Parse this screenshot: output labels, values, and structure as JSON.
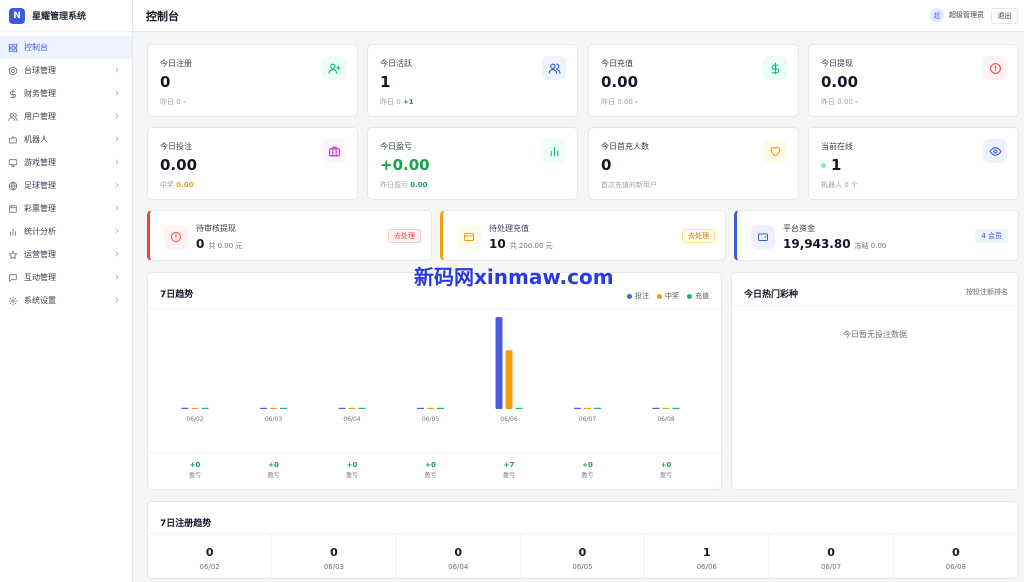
{
  "app": {
    "brand_initial": "N",
    "brand_name": "星耀管理系统"
  },
  "sidebar": {
    "items": [
      {
        "key": "dashboard",
        "label": "控制台",
        "icon": "dashboard-icon",
        "active": true,
        "has_children": false
      },
      {
        "key": "table-ball",
        "label": "台球管理",
        "icon": "target-icon",
        "active": false,
        "has_children": true
      },
      {
        "key": "finance",
        "label": "财务管理",
        "icon": "dollar-icon",
        "active": false,
        "has_children": true
      },
      {
        "key": "users",
        "label": "用户管理",
        "icon": "users-icon",
        "active": false,
        "has_children": true
      },
      {
        "key": "robots",
        "label": "机器人",
        "icon": "robot-icon",
        "active": false,
        "has_children": true
      },
      {
        "key": "games",
        "label": "游戏管理",
        "icon": "monitor-icon",
        "active": false,
        "has_children": true
      },
      {
        "key": "football",
        "label": "足球管理",
        "icon": "globe-icon",
        "active": false,
        "has_children": true
      },
      {
        "key": "lottery",
        "label": "彩票管理",
        "icon": "ticket-icon",
        "active": false,
        "has_children": true
      },
      {
        "key": "stats",
        "label": "统计分析",
        "icon": "bar-chart-icon",
        "active": false,
        "has_children": true
      },
      {
        "key": "operations",
        "label": "运营管理",
        "icon": "star-icon",
        "active": false,
        "has_children": true
      },
      {
        "key": "interaction",
        "label": "互动管理",
        "icon": "message-icon",
        "active": false,
        "has_children": true
      },
      {
        "key": "settings",
        "label": "系统设置",
        "icon": "gear-icon",
        "active": false,
        "has_children": true
      }
    ]
  },
  "header": {
    "title": "控制台",
    "avatar_text": "超",
    "admin_name": "超级管理员",
    "logout_label": "退出"
  },
  "stats": [
    {
      "label": "今日注册",
      "value": "0",
      "sub_prefix": "昨日 0",
      "sub_highlight": "-",
      "highlight_color": "#9ca3af",
      "icon": "user-plus-icon",
      "icon_bg": "#ecfdf5",
      "icon_color": "#10b981"
    },
    {
      "label": "今日活跃",
      "value": "1",
      "sub_prefix": "昨日 0",
      "sub_highlight": "+1",
      "highlight_color": "#16a34a",
      "icon": "users-icon",
      "icon_bg": "#eef2ff",
      "icon_color": "#3b5bdb"
    },
    {
      "label": "今日充值",
      "value": "0.00",
      "sub_prefix": "昨日 0.00",
      "sub_highlight": "-",
      "highlight_color": "#9ca3af",
      "icon": "dollar-icon",
      "icon_bg": "#ecfdf5",
      "icon_color": "#10b981"
    },
    {
      "label": "今日提现",
      "value": "0.00",
      "sub_prefix": "昨日 0.00",
      "sub_highlight": "-",
      "highlight_color": "#9ca3af",
      "icon": "alert-circle-icon",
      "icon_bg": "#fef2f2",
      "icon_color": "#ef4444"
    },
    {
      "label": "今日投注",
      "value": "0.00",
      "sub_prefix": "中奖",
      "sub_highlight": "0.00",
      "highlight_color": "#f59e0b",
      "icon": "briefcase-icon",
      "icon_bg": "#fdf4ff",
      "icon_color": "#c026d3"
    },
    {
      "label": "今日盈亏",
      "value": "+0.00",
      "value_color": "#16a34a",
      "sub_prefix": "昨日盈亏",
      "sub_highlight": "0.00",
      "highlight_color": "#16a34a",
      "icon": "bar-chart-icon",
      "icon_bg": "#ecfdf5",
      "icon_color": "#10b981"
    },
    {
      "label": "今日首充人数",
      "value": "0",
      "sub_prefix": "首次充值的新用户",
      "sub_highlight": "",
      "highlight_color": "#9ca3af",
      "icon": "heart-icon",
      "icon_bg": "#fffbeb",
      "icon_color": "#f59e0b"
    },
    {
      "label": "当前在线",
      "value": "1",
      "dot": true,
      "sub_prefix": "机器人 0 个",
      "sub_highlight": "",
      "highlight_color": "#9ca3af",
      "icon": "eye-icon",
      "icon_bg": "#eef2ff",
      "icon_color": "#3b5bdb"
    }
  ],
  "pending": [
    {
      "label": "待审核提现",
      "value": "0",
      "detail": "共 0.00 元",
      "button": "去处理",
      "accent": "#ef4444",
      "icon": "alert-circle-icon",
      "icon_bg": "#fef2f2",
      "btn_bg": "#fef2f2",
      "btn_color": "#ef4444",
      "btn_border": "#fecaca"
    },
    {
      "label": "待处理充值",
      "value": "10",
      "detail": "共 200.00 元",
      "button": "去处理",
      "accent": "#f59e0b",
      "icon": "credit-card-icon",
      "icon_bg": "#fffbeb",
      "btn_bg": "#fffbeb",
      "btn_color": "#d97706",
      "btn_border": "#fde68a"
    },
    {
      "label": "平台资金",
      "value": "19,943.80",
      "detail": "冻结 0.00",
      "button": "4 会员",
      "accent": "#3b5bdb",
      "icon": "wallet-icon",
      "icon_bg": "#eef2ff",
      "btn_bg": "#eef2ff",
      "btn_color": "#3b5bdb",
      "btn_border": "#eef2ff"
    }
  ],
  "trend": {
    "title": "7日趋势",
    "chart_data": {
      "type": "bar",
      "categories": [
        "06/02",
        "06/03",
        "06/04",
        "06/05",
        "06/06",
        "06/07",
        "06/08"
      ],
      "series": [
        {
          "name": "投注",
          "color": "#4c5fe0",
          "values": [
            0,
            0,
            0,
            0,
            2500,
            0,
            0
          ]
        },
        {
          "name": "中奖",
          "color": "#f59e0b",
          "values": [
            0,
            0,
            0,
            0,
            1600,
            0,
            0
          ]
        },
        {
          "name": "充值",
          "color": "#10b981",
          "values": [
            0,
            0,
            0,
            0,
            0,
            0,
            0
          ]
        }
      ],
      "profit": [
        "+0",
        "+0",
        "+0",
        "+0",
        "+7",
        "+0",
        "+0"
      ],
      "profit_label": "盈亏"
    }
  },
  "hot": {
    "title": "今日热门彩种",
    "rank_label": "按投注额排名",
    "empty": "今日暂无投注数据"
  },
  "registration": {
    "title": "7日注册趋势",
    "days": [
      {
        "date": "06/02",
        "value": "0"
      },
      {
        "date": "06/03",
        "value": "0"
      },
      {
        "date": "06/04",
        "value": "0"
      },
      {
        "date": "06/05",
        "value": "0"
      },
      {
        "date": "06/06",
        "value": "1"
      },
      {
        "date": "06/07",
        "value": "0"
      },
      {
        "date": "06/08",
        "value": "0"
      }
    ]
  },
  "watermark": "新码网xinmaw.com"
}
